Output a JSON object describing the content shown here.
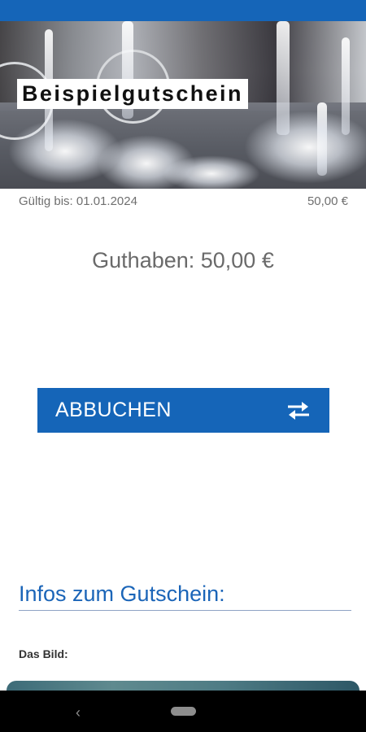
{
  "voucher": {
    "title": "Beispielgutschein",
    "valid_until": "Gültig bis: 01.01.2024",
    "amount": "50,00 €",
    "balance": "Guthaben: 50,00 €"
  },
  "actions": {
    "debit_label": "ABBUCHEN",
    "debit_icon": "swap-arrows-icon"
  },
  "info": {
    "heading": "Infos zum Gutschein:",
    "image_label": "Das Bild:"
  },
  "nav": {
    "back_glyph": "‹"
  },
  "colors": {
    "accent": "#1565b8",
    "status_bar": "#1565b8",
    "nav_bar": "#000000"
  }
}
